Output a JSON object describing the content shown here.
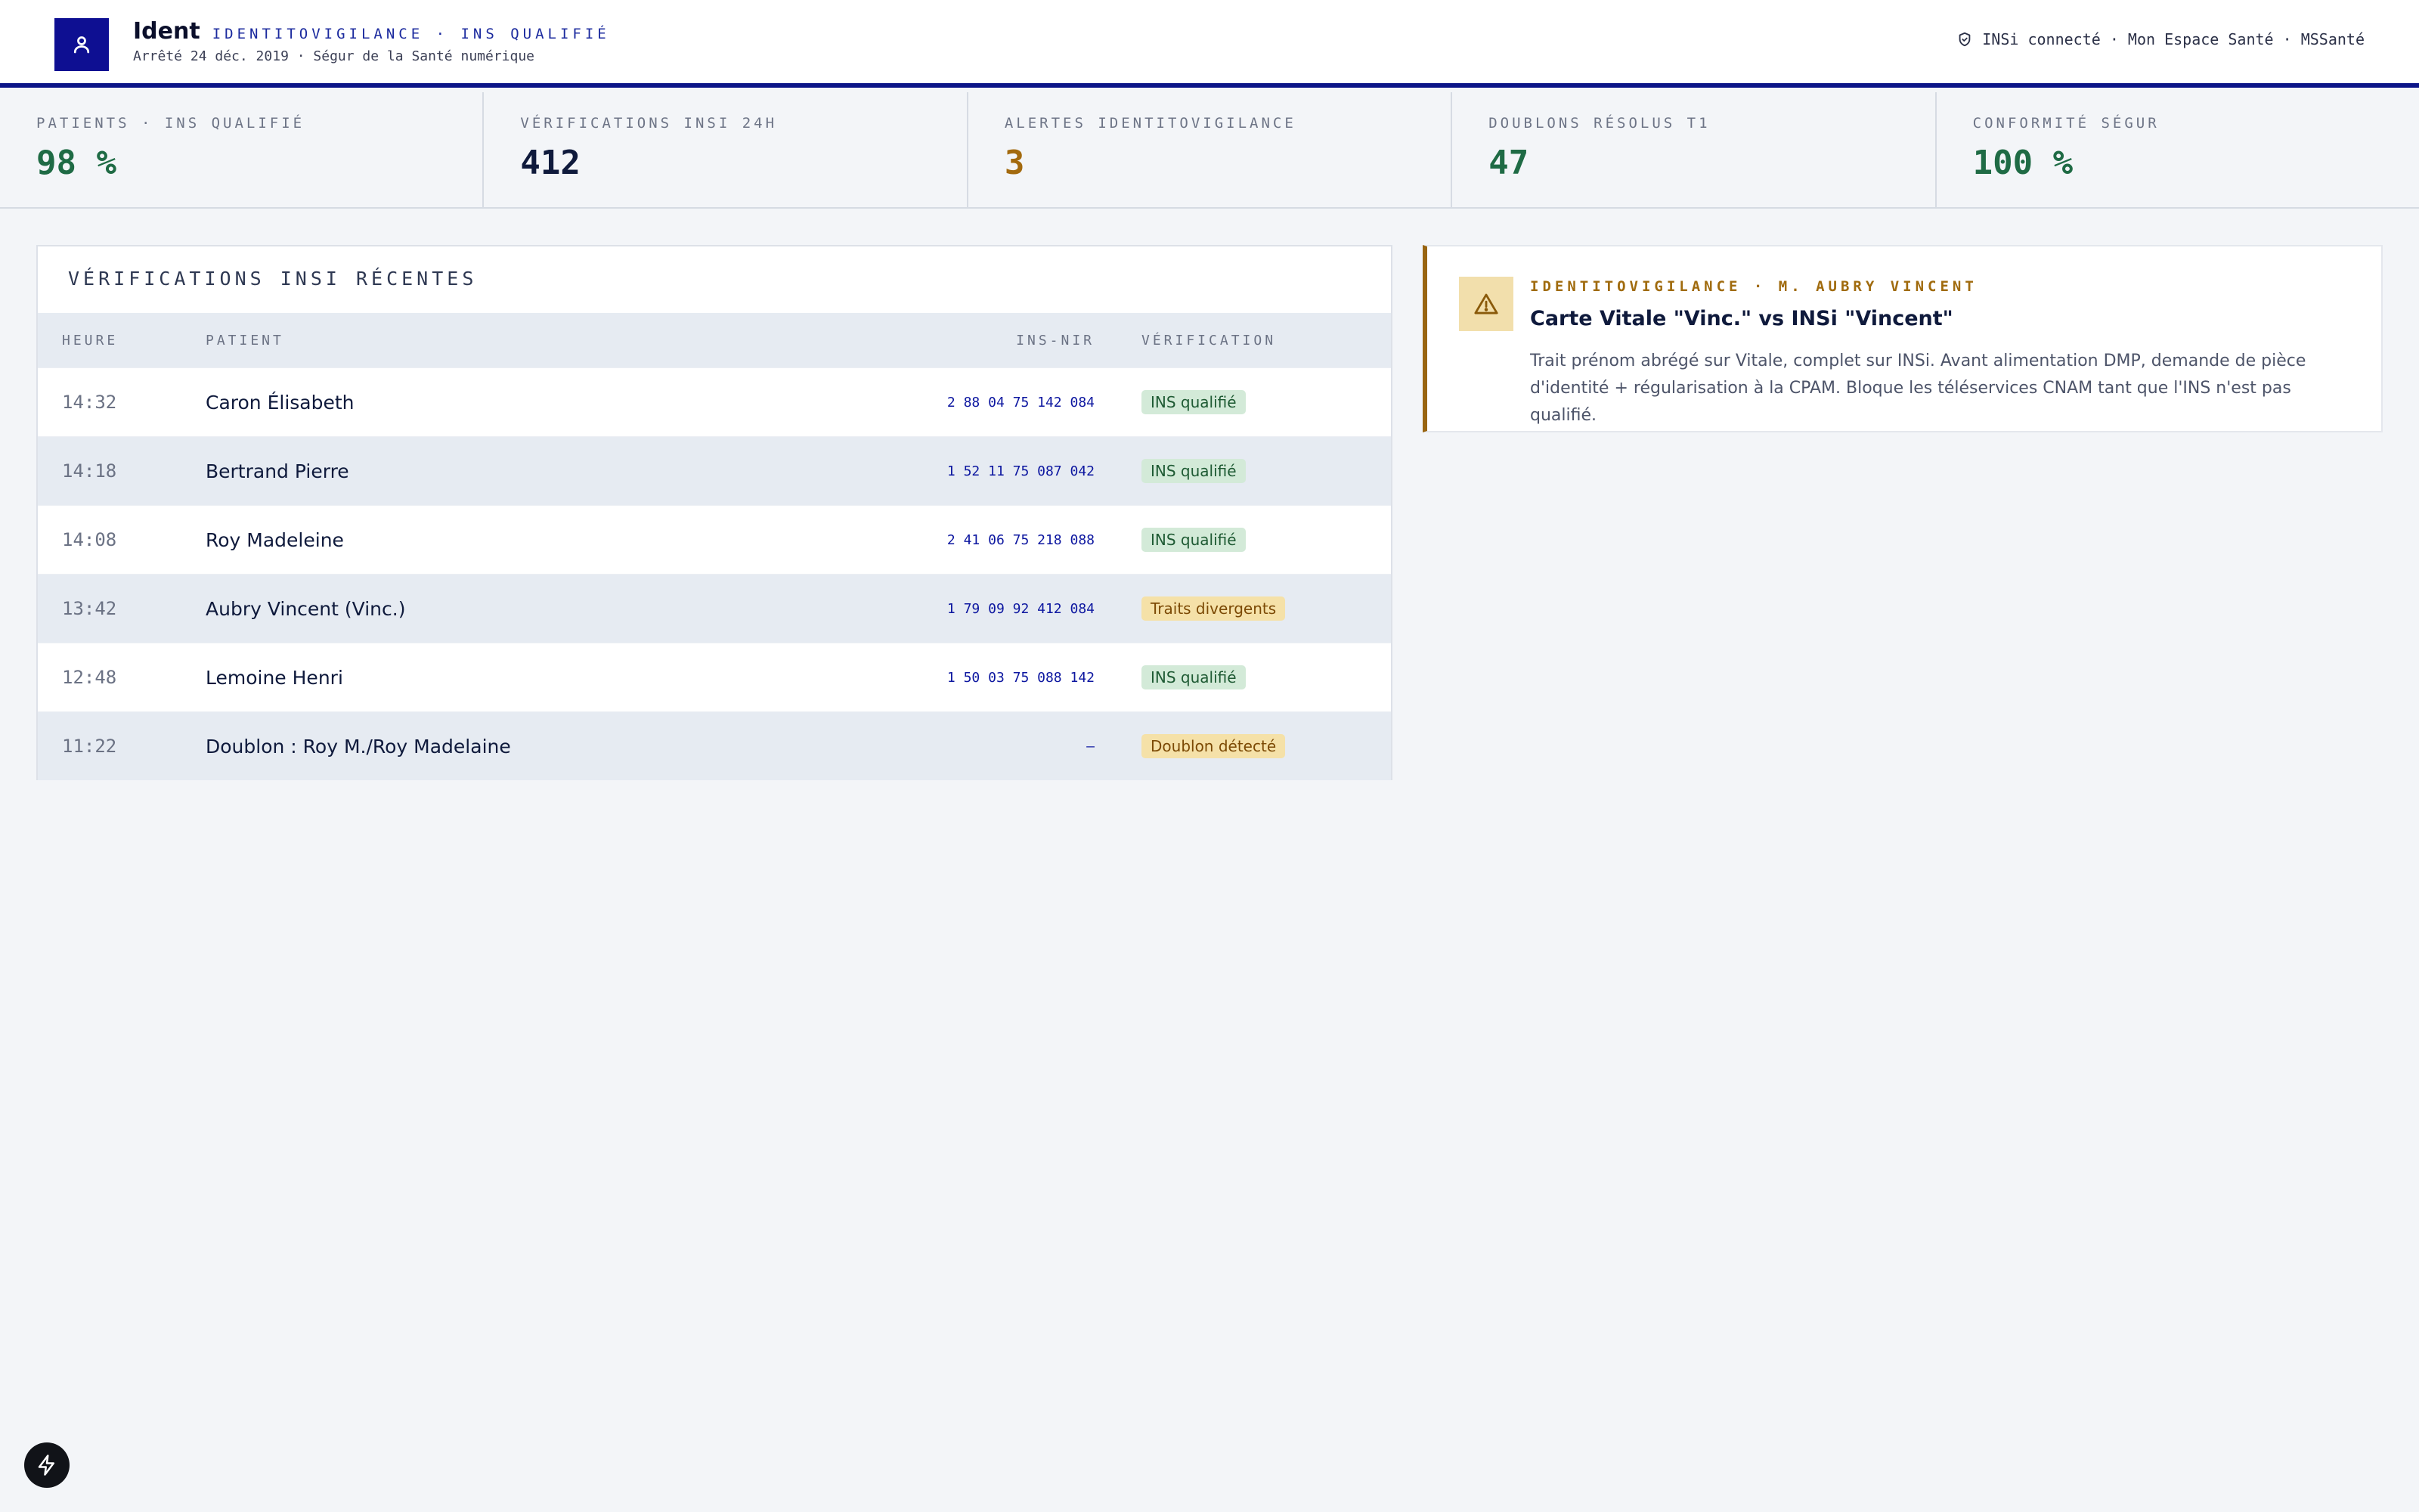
{
  "header": {
    "brand_name": "Ident",
    "brand_tag": "IDENTITOVIGILANCE · INS QUALIFIÉ",
    "subtitle": "Arrêté 24 déc. 2019 · Ségur de la Santé numérique",
    "status": "INSi connecté · Mon Espace Santé · MSSanté"
  },
  "kpis": [
    {
      "label": "PATIENTS · INS QUALIFIÉ",
      "value": "98 %",
      "color": "#1f6b45"
    },
    {
      "label": "VÉRIFICATIONS INSI 24H",
      "value": "412",
      "color": "#0f1a3c"
    },
    {
      "label": "ALERTES IDENTITOVIGILANCE",
      "value": "3",
      "color": "#a36a0e"
    },
    {
      "label": "DOUBLONS RÉSOLUS T1",
      "value": "47",
      "color": "#1f6b45"
    },
    {
      "label": "CONFORMITÉ SÉGUR",
      "value": "100 %",
      "color": "#1f6b45"
    }
  ],
  "table": {
    "title": "VÉRIFICATIONS INSI RÉCENTES",
    "columns": {
      "time": "HEURE",
      "patient": "PATIENT",
      "ins": "INS-NIR",
      "verification": "VÉRIFICATION"
    },
    "rows": [
      {
        "time": "14:32",
        "patient": "Caron Élisabeth",
        "ins": "2 88 04 75 142 084",
        "status": "INS qualifié",
        "status_type": "ok"
      },
      {
        "time": "14:18",
        "patient": "Bertrand Pierre",
        "ins": "1 52 11 75 087 042",
        "status": "INS qualifié",
        "status_type": "ok"
      },
      {
        "time": "14:08",
        "patient": "Roy Madeleine",
        "ins": "2 41 06 75 218 088",
        "status": "INS qualifié",
        "status_type": "ok"
      },
      {
        "time": "13:42",
        "patient": "Aubry Vincent (Vinc.)",
        "ins": "1 79 09 92 412 084",
        "status": "Traits divergents",
        "status_type": "warn"
      },
      {
        "time": "12:48",
        "patient": "Lemoine Henri",
        "ins": "1 50 03 75 088 142",
        "status": "INS qualifié",
        "status_type": "ok"
      },
      {
        "time": "11:22",
        "patient": "Doublon : Roy M./Roy Madelaine",
        "ins": "–",
        "status": "Doublon détecté",
        "status_type": "warn"
      }
    ]
  },
  "alert": {
    "kicker": "IDENTITOVIGILANCE · M. AUBRY VINCENT",
    "title": "Carte Vitale \"Vinc.\" vs INSi \"Vincent\"",
    "body_line1": "Trait prénom abrégé sur Vitale, complet sur INSi. Avant alimentation DMP, demande de pièce",
    "body_line2": "d'identité + régularisation à la CPAM. Bloque les téléservices CNAM tant que l'INS n'est pas qualifié."
  },
  "icons": {
    "logo": "user-icon",
    "status": "shield-check-icon",
    "alert": "warning-triangle-icon",
    "fab": "bolt-icon"
  }
}
